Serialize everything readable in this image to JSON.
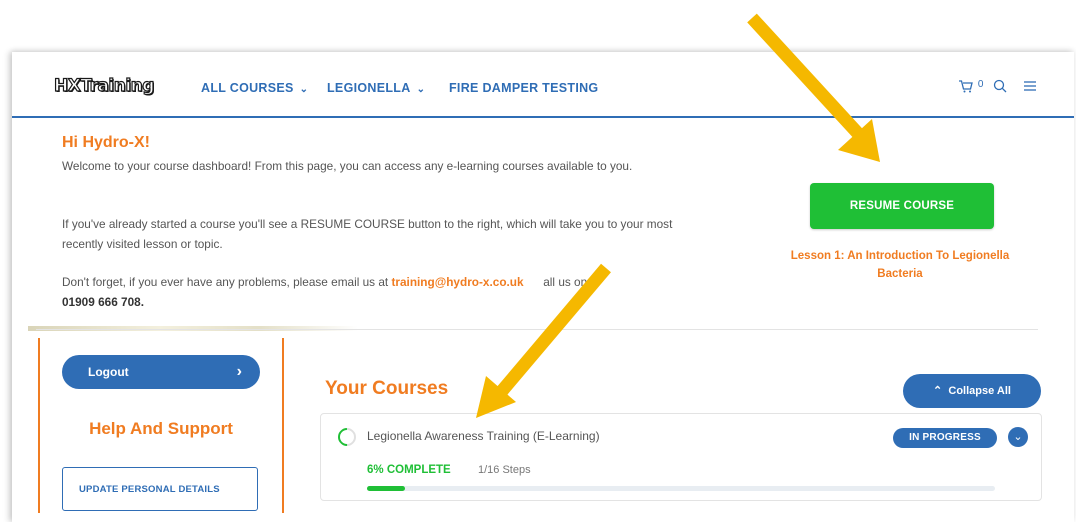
{
  "header": {
    "logo": "HXTraining",
    "nav": [
      {
        "label": "ALL COURSES",
        "has_dropdown": true
      },
      {
        "label": "LEGIONELLA",
        "has_dropdown": true
      },
      {
        "label": "FIRE DAMPER TESTING",
        "has_dropdown": false
      }
    ],
    "cart_count": "0",
    "icons": [
      "cart-icon",
      "search-icon",
      "menu-icon"
    ]
  },
  "welcome": {
    "greeting": "Hi Hydro-X!",
    "para1": "Welcome to your course dashboard!  From this page, you can access any e-learning courses available to you.",
    "para2": "If you've already started a course you'll see a RESUME COURSE button to the right, which will take you to your most recently visited lesson or topic.",
    "para3_prefix": "Don't forget, if you ever have any problems, please email us at ",
    "email": "training@hydro-x.co.uk",
    "para3_mid": "      all us on",
    "phone": "01909 666 708."
  },
  "resume": {
    "button_label": "RESUME COURSE",
    "lesson": "Lesson 1: An Introduction To Legionella Bacteria"
  },
  "sidebar": {
    "logout_label": "Logout",
    "logout_arrow": "›",
    "help_title": "Help And Support",
    "update_details_label": "UPDATE PERSONAL DETAILS"
  },
  "courses": {
    "heading": "Your Courses",
    "collapse_label": "Collapse All",
    "items": [
      {
        "title": "Legionella Awareness Training (E-Learning)",
        "status": "IN PROGRESS",
        "percent_label": "6% COMPLETE",
        "steps_label": "1/16 Steps",
        "progress_fraction": 0.06
      }
    ]
  },
  "colors": {
    "brand_blue": "#2f6db5",
    "accent_orange": "#f07c21",
    "success_green": "#1fbf36",
    "annotation_arrow": "#f5b800"
  }
}
